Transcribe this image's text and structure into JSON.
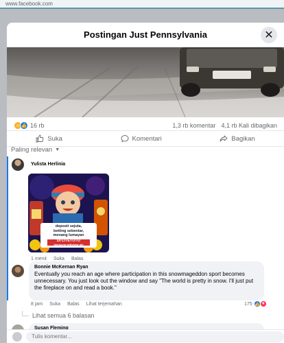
{
  "browser": {
    "url": "www.facebook.com"
  },
  "modal": {
    "title": "Postingan Just Pennsylvania",
    "close_glyph": "✕"
  },
  "reactions": {
    "count": "16 rb",
    "comments": "1,3 rb komentar",
    "shares": "4,1 rb Kali dibagikan"
  },
  "actions": {
    "like": "Suka",
    "comment": "Komentari",
    "share": "Bagikan"
  },
  "sort": {
    "label": "Paling relevan"
  },
  "comments": [
    {
      "name": "Yulista Herlinia",
      "image_text": {
        "line1": "deposit sejuta,",
        "line2": "betting sebentar,",
        "line3": "menang lumayan",
        "brand": "DI LITETOTO",
        "sub": "langsung withdraw aja"
      },
      "time": "1 menit",
      "like": "Suka",
      "reply": "Balas"
    },
    {
      "name": "Bonnie McKernan Ryan",
      "text": "Eventually you reach an age where participation in this snowmageddon sport becomes unnecessary. You just look out the window and say \"The world is pretty in snow. I'll just put the fireplace on and read a book.\"",
      "time": "8 jam",
      "like": "Suka",
      "reply": "Balas",
      "translate": "Lihat terjemahan",
      "reaction_count": "175"
    }
  ],
  "see_replies": "Lihat semua 6 balasan",
  "next_comment_name": "Susan Fleming",
  "compose": {
    "placeholder": "Tulis komentar..."
  },
  "colors": {
    "accent": "#1877f2",
    "haha": "#f7b125",
    "love": "#f33e58",
    "text_secondary": "#65676b",
    "bubble": "#f0f2f5"
  }
}
